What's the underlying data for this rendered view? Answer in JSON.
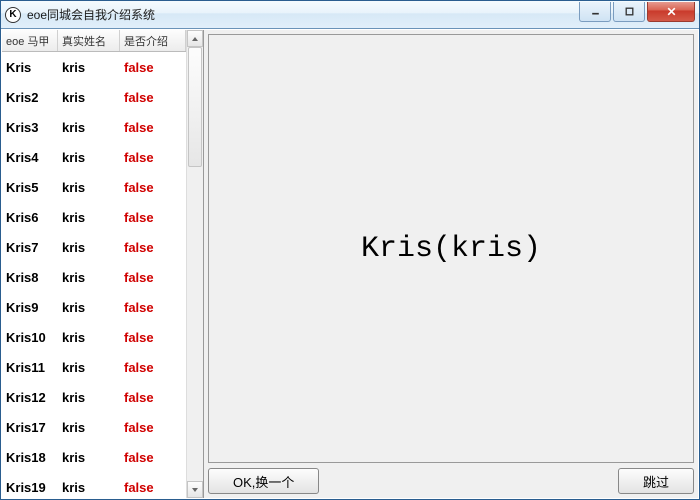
{
  "window": {
    "title": "eoe同城会自我介绍系统",
    "app_icon_letter": "K"
  },
  "table": {
    "headers": {
      "c1": "eoe 马甲",
      "c2": "真实姓名",
      "c3": "是否介绍"
    },
    "rows": [
      {
        "c1": "Kris",
        "c2": "kris",
        "c3": "false"
      },
      {
        "c1": "Kris2",
        "c2": "kris",
        "c3": "false"
      },
      {
        "c1": "Kris3",
        "c2": "kris",
        "c3": "false"
      },
      {
        "c1": "Kris4",
        "c2": "kris",
        "c3": "false"
      },
      {
        "c1": "Kris5",
        "c2": "kris",
        "c3": "false"
      },
      {
        "c1": "Kris6",
        "c2": "kris",
        "c3": "false"
      },
      {
        "c1": "Kris7",
        "c2": "kris",
        "c3": "false"
      },
      {
        "c1": "Kris8",
        "c2": "kris",
        "c3": "false"
      },
      {
        "c1": "Kris9",
        "c2": "kris",
        "c3": "false"
      },
      {
        "c1": "Kris10",
        "c2": "kris",
        "c3": "false"
      },
      {
        "c1": "Kris11",
        "c2": "kris",
        "c3": "false"
      },
      {
        "c1": "Kris12",
        "c2": "kris",
        "c3": "false"
      },
      {
        "c1": "Kris17",
        "c2": "kris",
        "c3": "false"
      },
      {
        "c1": "Kris18",
        "c2": "kris",
        "c3": "false"
      },
      {
        "c1": "Kris19",
        "c2": "kris",
        "c3": "false"
      }
    ]
  },
  "main": {
    "display_name": "Kris(kris)"
  },
  "buttons": {
    "ok": "OK,换一个",
    "skip": "跳过"
  },
  "colors": {
    "false_color": "#d00000"
  }
}
